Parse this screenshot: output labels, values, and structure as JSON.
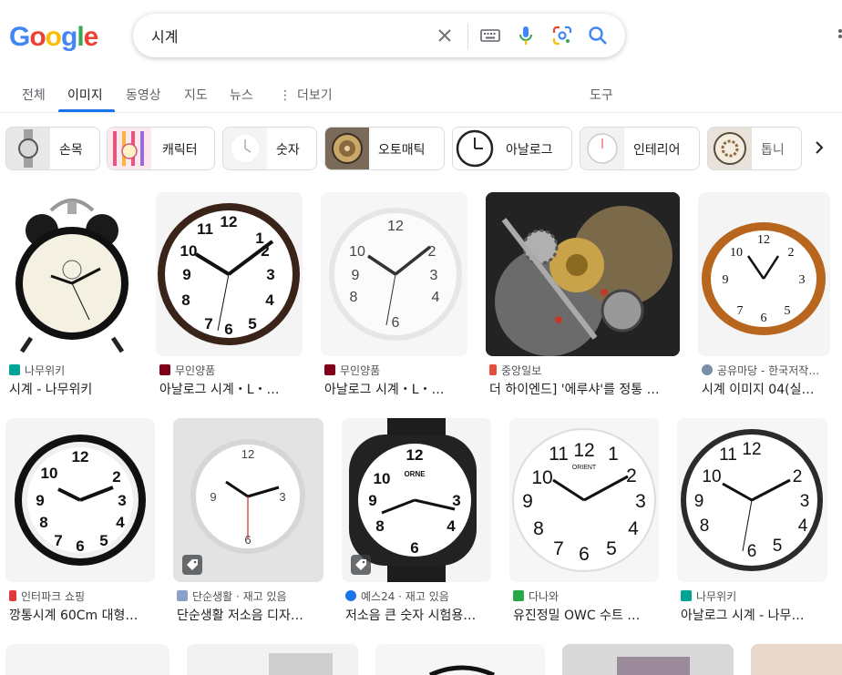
{
  "header": {
    "logo": [
      "G",
      "o",
      "o",
      "g",
      "l",
      "e"
    ],
    "search_value": "시계"
  },
  "tabs": [
    "전체",
    "이미지",
    "동영상",
    "지도",
    "뉴스",
    "더보기",
    "도구"
  ],
  "chips": [
    "손목",
    "캐릭터",
    "숫자",
    "오토매틱",
    "아날로그",
    "인테리어",
    "톱니"
  ],
  "results": [
    {
      "source": "나무위키",
      "title": "시계 - 나무위키",
      "fav_color": "#00a495"
    },
    {
      "source": "무인양품",
      "title": "아날로그 시계・L・…",
      "fav_color": "#7f0019"
    },
    {
      "source": "무인양품",
      "title": "아날로그 시계・L・…",
      "fav_color": "#7f0019"
    },
    {
      "source": "중앙일보",
      "title": "더 하이엔드] '에루샤'를 정통 …",
      "fav_color": "#e74c3c"
    },
    {
      "source": "공유마당 - 한국저작…",
      "title": "시계 이미지 04(실…",
      "fav_color": "#7b8ea8"
    },
    {
      "source": "인터파크 쇼핑",
      "title": "깡통시계 60Cm 대형…",
      "fav_color": "#e03a3a"
    },
    {
      "source": "단순생활 · 재고 있음",
      "title": "단순생활 저소음 디자…",
      "fav_color": "#8aa0c8"
    },
    {
      "source": "예스24 · 재고 있음",
      "title": "저소음 큰 숫자 시험용…",
      "fav_color": "#1a73e8"
    },
    {
      "source": "다나와",
      "title": "유진정밀 OWC 수트 …",
      "fav_color": "#28a745"
    },
    {
      "source": "나무위키",
      "title": "아날로그 시계 - 나무…",
      "fav_color": "#00a495"
    }
  ],
  "colors": {
    "accent": "#1a73e8",
    "text": "#202124",
    "secondary": "#5f6368"
  }
}
